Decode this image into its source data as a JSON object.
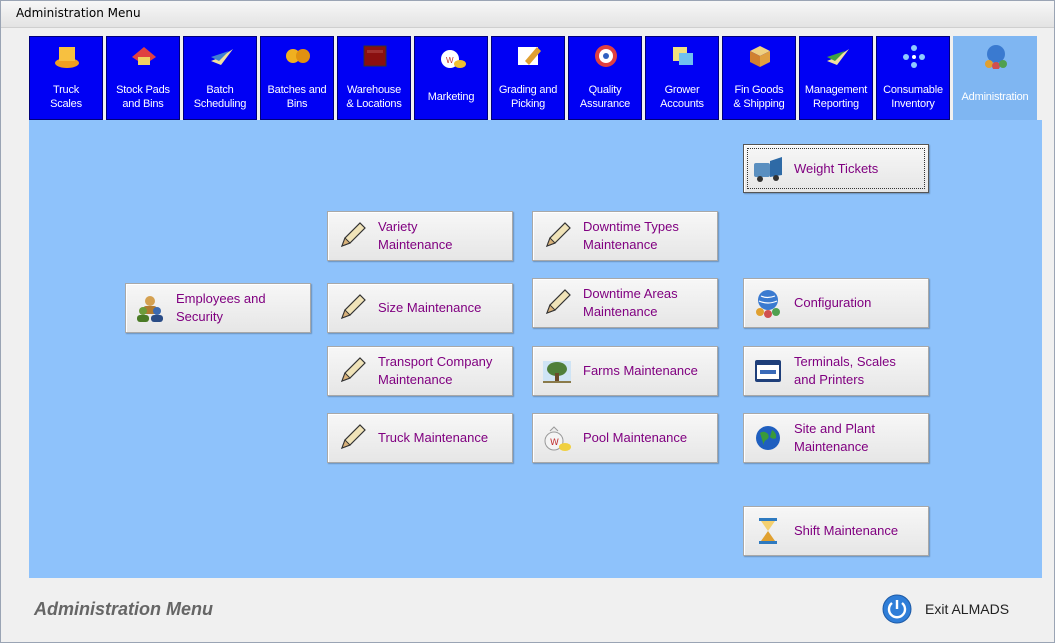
{
  "window": {
    "title": "Administration Menu"
  },
  "tabs": [
    {
      "label": "Truck\nScales",
      "icon": "truck-scales-icon"
    },
    {
      "label": "Stock Pads\nand Bins",
      "icon": "stock-pads-icon"
    },
    {
      "label": "Batch\nScheduling",
      "icon": "batch-scheduling-icon"
    },
    {
      "label": "Batches and\nBins",
      "icon": "batches-icon"
    },
    {
      "label": "Warehouse\n& Locations",
      "icon": "warehouse-icon"
    },
    {
      "label": "Marketing",
      "icon": "marketing-icon"
    },
    {
      "label": "Grading and\nPicking",
      "icon": "grading-icon"
    },
    {
      "label": "Quality\nAssurance",
      "icon": "quality-icon"
    },
    {
      "label": "Grower\nAccounts",
      "icon": "grower-icon"
    },
    {
      "label": "Fin Goods\n& Shipping",
      "icon": "fin-goods-icon"
    },
    {
      "label": "Management\nReporting",
      "icon": "management-icon"
    },
    {
      "label": "Consumable\nInventory",
      "icon": "consumable-icon"
    },
    {
      "label": "Administration",
      "icon": "administration-icon",
      "active": true
    }
  ],
  "buttons": {
    "weight_tickets": "Weight Tickets",
    "variety_maintenance": "Variety\nMaintenance",
    "downtime_types": "Downtime Types\nMaintenance",
    "employees_security": "Employees and\nSecurity",
    "size_maintenance": "Size Maintenance",
    "downtime_areas": "Downtime Areas\nMaintenance",
    "configuration": "Configuration",
    "transport_company": "Transport Company\nMaintenance",
    "farms_maintenance": "Farms Maintenance",
    "terminals": "Terminals, Scales\nand Printers",
    "truck_maintenance": "Truck Maintenance",
    "pool_maintenance": "Pool Maintenance",
    "site_plant": "Site and Plant\nMaintenance",
    "shift_maintenance": "Shift Maintenance"
  },
  "footer": {
    "title": "Administration Menu",
    "exit_label": "Exit ALMADS"
  },
  "colors": {
    "tab_bg": "#0000f4",
    "tab_active": "#7fb6f2",
    "content_bg": "#8ec2fb",
    "button_text": "#800080"
  }
}
